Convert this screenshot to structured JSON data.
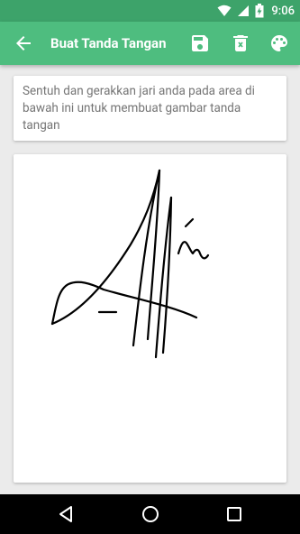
{
  "status_bar": {
    "time": "9:06",
    "icons": [
      "wifi-icon",
      "signal-icon",
      "battery-icon"
    ]
  },
  "app_bar": {
    "title": "Buat Tanda Tangan",
    "background_color": "#4ebd7f",
    "actions": [
      "save-icon",
      "delete-icon",
      "palette-icon"
    ]
  },
  "instruction": {
    "text": "Sentuh dan gerakkan jari anda pada area di bawah ini untuk membuat gambar tanda tangan"
  },
  "signature_pad": {
    "ink_color": "#000000",
    "background_color": "#ffffff"
  },
  "nav_bar": {
    "buttons": [
      "back-triangle-icon",
      "home-circle-icon",
      "recents-square-icon"
    ]
  }
}
